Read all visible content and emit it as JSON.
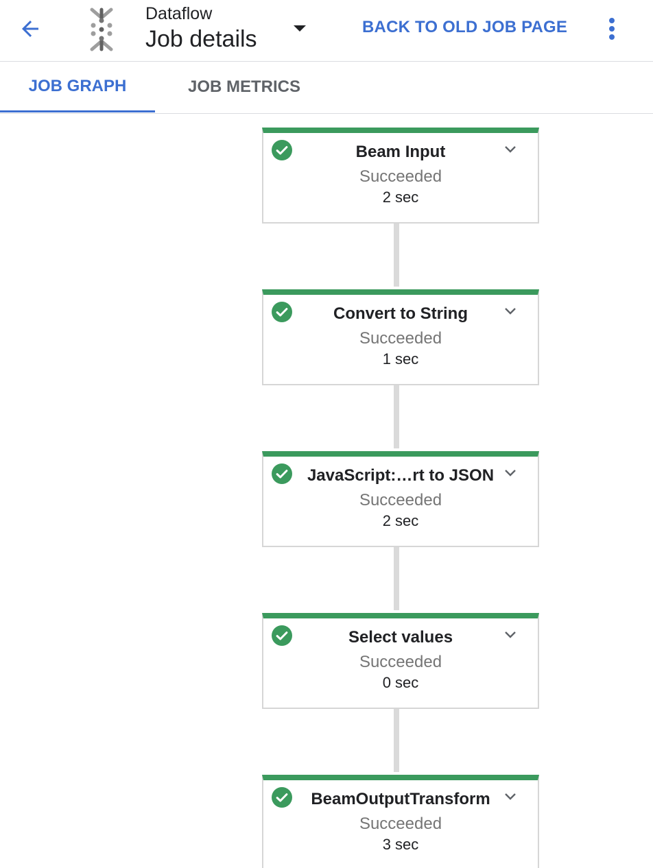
{
  "header": {
    "product_name": "Dataflow",
    "page_title": "Job details",
    "back_old_label": "BACK TO OLD JOB PAGE",
    "accent_color": "#3c6fd1"
  },
  "tabs": [
    {
      "label": "JOB GRAPH",
      "active": true
    },
    {
      "label": "JOB METRICS",
      "active": false
    }
  ],
  "graph": {
    "success_color": "#3b9a5d",
    "nodes": [
      {
        "name": "Beam Input",
        "status": "Succeeded",
        "duration": "2 sec",
        "icon": "check-circle-icon"
      },
      {
        "name": "Convert to String",
        "status": "Succeeded",
        "duration": "1 sec",
        "icon": "check-circle-icon"
      },
      {
        "name": "JavaScript:…rt to JSON",
        "status": "Succeeded",
        "duration": "2 sec",
        "icon": "check-circle-icon"
      },
      {
        "name": "Select values",
        "status": "Succeeded",
        "duration": "0 sec",
        "icon": "check-circle-icon"
      },
      {
        "name": "BeamOutputTransform",
        "status": "Succeeded",
        "duration": "3 sec",
        "icon": "check-circle-icon"
      }
    ]
  }
}
